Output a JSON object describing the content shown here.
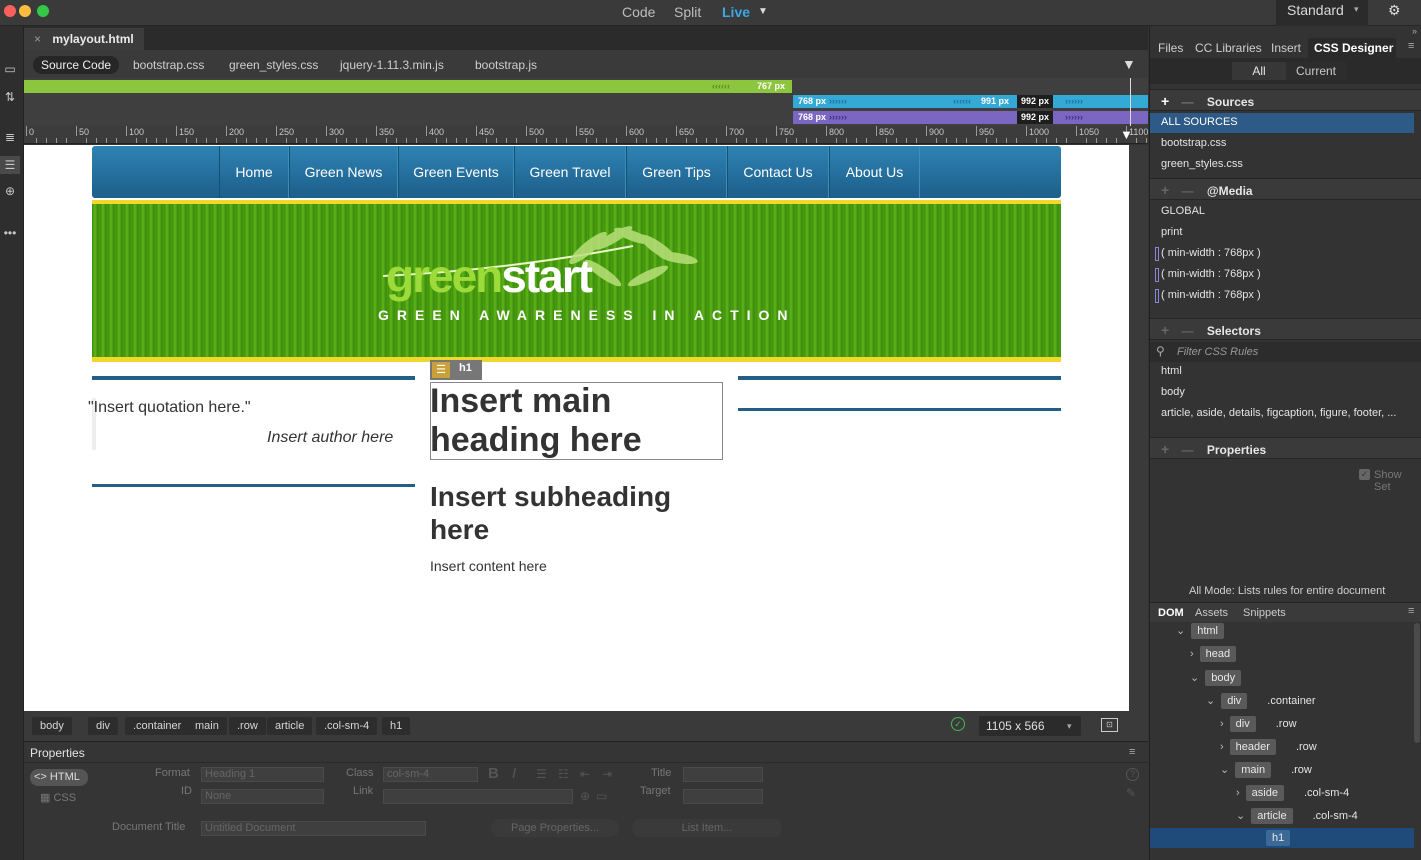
{
  "titlebar": {
    "views": [
      "Code",
      "Split",
      "Live"
    ],
    "active_view": "Live",
    "workspace": "Standard"
  },
  "document": {
    "filename": "mylayout.html",
    "related_files": [
      "Source Code",
      "bootstrap.css",
      "green_styles.css",
      "jquery-1.11.3.min.js",
      "bootstrap.js"
    ]
  },
  "media_bars": {
    "bar1": "767 px",
    "bar2a": "768 px",
    "bar2b": "991 px",
    "bar2c": "992 px",
    "bar3a": "768 px",
    "bar3b": "992 px"
  },
  "ruler_labels": [
    "0",
    "50",
    "100",
    "150",
    "200",
    "250",
    "300",
    "350",
    "400",
    "450",
    "500",
    "550",
    "600",
    "650",
    "700",
    "750",
    "800",
    "850",
    "900",
    "950",
    "1000",
    "1050",
    "1100"
  ],
  "page": {
    "nav": [
      "Home",
      "Green News",
      "Green Events",
      "Green Travel",
      "Green Tips",
      "Contact Us",
      "About Us"
    ],
    "logo_green": "green",
    "logo_white": "start",
    "tagline": "GREEN AWARENESS IN ACTION",
    "quote": "\"Insert quotation here.\"",
    "author": "Insert author here",
    "element_tag": "h1",
    "heading": "Insert main heading here",
    "subheading": "Insert subheading here",
    "content": "Insert content here"
  },
  "statusbar": {
    "breadcrumbs": [
      "body",
      "div",
      ".container",
      "main",
      ".row",
      "article",
      ".col-sm-4",
      "h1"
    ],
    "size": "1105 x 566"
  },
  "properties": {
    "title": "Properties",
    "html_btn": "HTML",
    "css_btn": "CSS",
    "format_label": "Format",
    "format_value": "Heading 1",
    "id_label": "ID",
    "id_value": "None",
    "class_label": "Class",
    "class_value": "col-sm-4",
    "link_label": "Link",
    "title_label": "Title",
    "target_label": "Target",
    "doc_title_label": "Document Title",
    "doc_title_value": "Untitled Document",
    "page_props_btn": "Page Properties...",
    "list_item_btn": "List Item..."
  },
  "right_panel": {
    "tabs": [
      "Files",
      "CC Libraries",
      "Insert",
      "CSS Designer"
    ],
    "active_tab": "CSS Designer",
    "filter_all": "All",
    "filter_current": "Current",
    "sources_title": "Sources",
    "sources": [
      "ALL SOURCES",
      "bootstrap.css",
      "green_styles.css"
    ],
    "media_title": "@Media",
    "media": [
      "GLOBAL",
      "print",
      "( min-width : 768px )",
      "( min-width : 768px )",
      "( min-width : 768px )"
    ],
    "selectors_title": "Selectors",
    "filter_placeholder": "Filter CSS Rules",
    "selectors": [
      "html",
      "body",
      "article, aside, details, figcaption, figure, footer, ..."
    ],
    "properties_title": "Properties",
    "show_set": "Show Set",
    "mode_note": "All Mode: Lists rules for entire document",
    "dom_tabs": [
      "DOM",
      "Assets",
      "Snippets"
    ],
    "dom_tree": [
      {
        "tag": "html",
        "cls": ""
      },
      {
        "tag": "head",
        "cls": ""
      },
      {
        "tag": "body",
        "cls": ""
      },
      {
        "tag": "div",
        "cls": ".container"
      },
      {
        "tag": "div",
        "cls": ".row"
      },
      {
        "tag": "header",
        "cls": ".row"
      },
      {
        "tag": "main",
        "cls": ".row"
      },
      {
        "tag": "aside",
        "cls": ".col-sm-4"
      },
      {
        "tag": "article",
        "cls": ".col-sm-4"
      },
      {
        "tag": "h1",
        "cls": ""
      }
    ]
  },
  "colors": {
    "accent_blue": "#35a9d6",
    "media_green": "#8cc63e",
    "media_purple": "#7b66c2",
    "nav_blue": "#2b7bad",
    "rule_blue": "#235e86"
  }
}
